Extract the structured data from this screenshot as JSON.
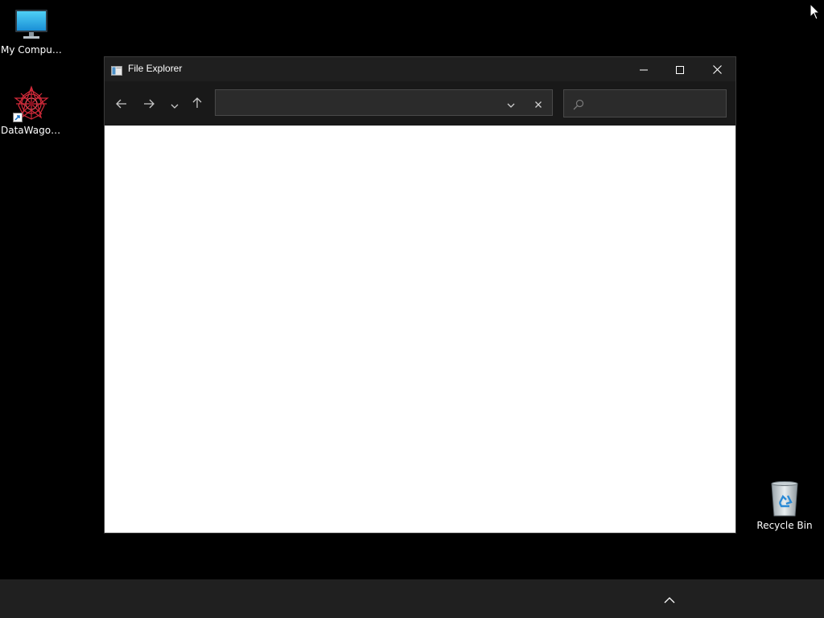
{
  "desktop": {
    "icons": [
      {
        "label": "My Computer",
        "icon": "monitor-icon"
      },
      {
        "label": "DataWagon...",
        "icon": "datawagon-app-icon"
      },
      {
        "label": "Recycle Bin",
        "icon": "recycle-bin-icon"
      }
    ]
  },
  "window": {
    "title": "File Explorer",
    "icon": "file-explorer-icon",
    "controls": {
      "minimize": "minimize-icon",
      "maximize": "maximize-icon",
      "close": "close-icon"
    },
    "toolbar": {
      "back": "arrow-left-icon",
      "forward": "arrow-right-icon",
      "recent": "chevron-down-icon",
      "up": "arrow-up-icon",
      "address_value": "",
      "search_value": ""
    }
  },
  "taskbar": {
    "tray_chevron": "chevron-up-icon"
  },
  "colors": {
    "desktop_bg": "#000000",
    "window_chrome": "#191919",
    "field_bg": "#2b2b2b",
    "taskbar_bg": "#202020",
    "content_bg": "#ffffff"
  }
}
